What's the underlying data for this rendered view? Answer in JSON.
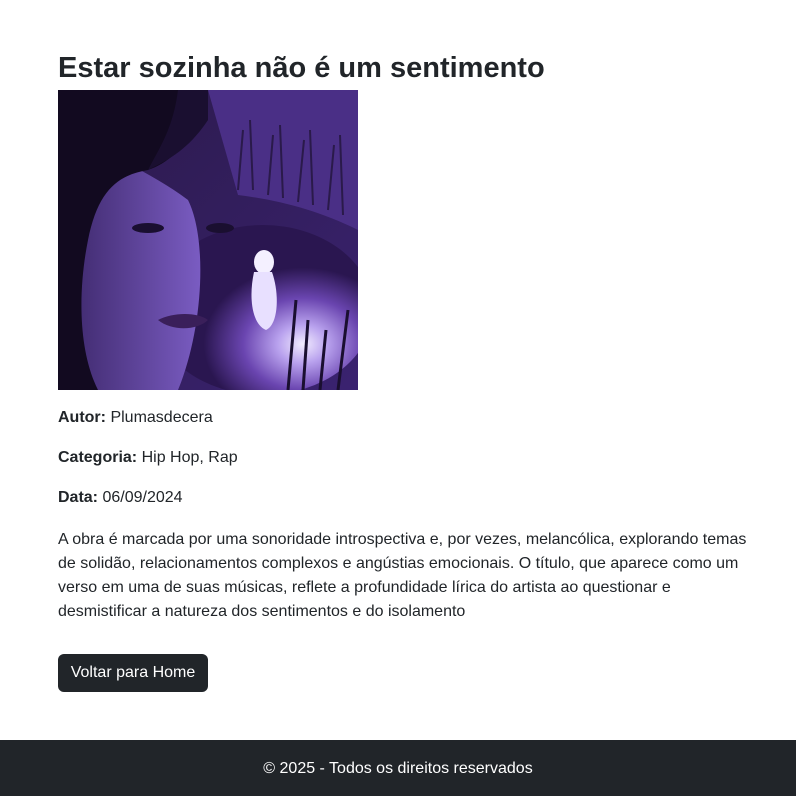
{
  "album": {
    "title": "Estar sozinha não é um sentimento",
    "author_label": "Autor:",
    "author": "Plumasdecera",
    "category_label": "Categoria:",
    "category": "Hip Hop, Rap",
    "date_label": "Data:",
    "date": "06/09/2024",
    "description": "A obra é marcada por uma sonoridade introspectiva e, por vezes, melancólica, explorando temas de solidão, relacionamentos complexos e angústias emocionais. O título, que aparece como um verso em uma de suas músicas, reflete a profundidade lírica do artista ao questionar e desmistificar a natureza dos sentimentos e do isolamento"
  },
  "actions": {
    "back_home_label": "Voltar para Home"
  },
  "footer": {
    "text": "© 2025 - Todos os direitos reservados"
  },
  "colors": {
    "dark": "#212529",
    "cover_purple": "#5b3a9a"
  }
}
